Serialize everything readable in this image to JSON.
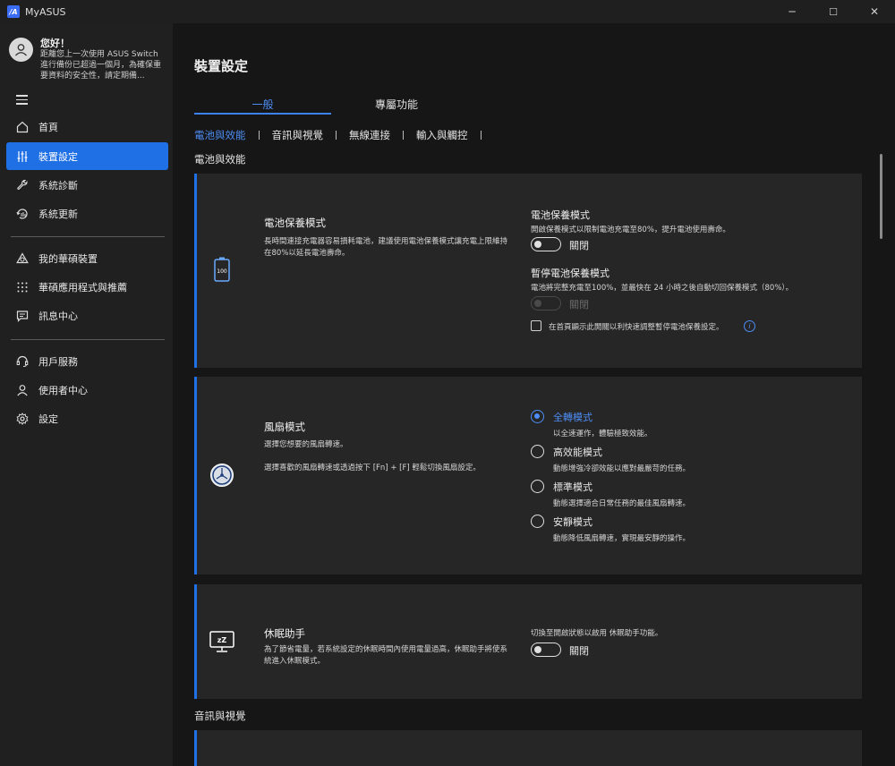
{
  "app": {
    "logo_text": "/A",
    "title": "MyASUS",
    "controls": {
      "minimize": "─",
      "maximize": "☐",
      "close": "✕"
    }
  },
  "sidebar": {
    "greeting": "您好！",
    "message": "距離您上一次使用 ASUS Switch 進行備份已超過一個月，為確保重要資料的安全性，請定期備...",
    "items": [
      {
        "label": "首頁",
        "icon": "home-icon"
      },
      {
        "label": "裝置設定",
        "icon": "sliders-icon",
        "active": true
      },
      {
        "label": "系統診斷",
        "icon": "wrench-icon"
      },
      {
        "label": "系統更新",
        "icon": "update-icon"
      },
      {
        "label": "我的華碩裝置",
        "icon": "devices-icon"
      },
      {
        "label": "華碩應用程式與推薦",
        "icon": "apps-grid-icon"
      },
      {
        "label": "訊息中心",
        "icon": "message-icon"
      },
      {
        "label": "用戶服務",
        "icon": "headset-icon"
      },
      {
        "label": "使用者中心",
        "icon": "user-icon"
      },
      {
        "label": "設定",
        "icon": "gear-icon"
      }
    ]
  },
  "main": {
    "title": "裝置設定",
    "tabs": [
      {
        "label": "一般",
        "active": true
      },
      {
        "label": "專屬功能"
      }
    ],
    "subnav": [
      "電池與效能",
      "音訊與視覺",
      "無線連接",
      "輸入與觸控"
    ],
    "section1": "電池與效能",
    "section2": "音訊與視覺",
    "battery": {
      "title": "電池保養模式",
      "desc": "長時間連接充電器容易損耗電池，建議使用電池保養模式讓充電上限維持在80%以延長電池壽命。",
      "icon_text": "100",
      "opt1_title": "電池保養模式",
      "opt1_desc": "開啟保養模式以限制電池充電至80%，提升電池使用壽命。",
      "opt1_state": "關閉",
      "opt2_title": "暫停電池保養模式",
      "opt2_desc": "電池將完整充電至100%，並最快在 24 小時之後自動切回保養模式（80%）。",
      "opt2_state": "關閉",
      "checkbox_label": "在首頁顯示此開關以利快速調整暫停電池保養設定。",
      "info": "i"
    },
    "fan": {
      "title": "風扇模式",
      "desc1": "選擇您想要的風扇轉速。",
      "desc2": "選擇喜歡的風扇轉速或透過按下 [Fn] + [F] 輕鬆切換風扇設定。",
      "options": [
        {
          "label": "全轉模式",
          "desc": "以全速運作，體驗極致效能。",
          "checked": true
        },
        {
          "label": "高效能模式",
          "desc": "動態增強冷卻效能以應對最嚴苛的任務。"
        },
        {
          "label": "標準模式",
          "desc": "動態選擇適合日常任務的最佳風扇轉速。"
        },
        {
          "label": "安靜模式",
          "desc": "動態降低風扇轉速，實現最安靜的操作。"
        }
      ]
    },
    "sleep": {
      "title": "休眠助手",
      "desc": "為了節省電量，若系統設定的休眠時間內使用電量過高，休眠助手將使系統進入休眠模式。",
      "icon_text": "zZ",
      "opt_desc": "切換至開啟狀態以啟用 休眠助手功能。",
      "state": "關閉"
    }
  },
  "colors": {
    "accent": "#1f6fe5",
    "accent_text": "#4d8df5",
    "sidebar_bg": "#202020",
    "card_bg": "#262626"
  }
}
